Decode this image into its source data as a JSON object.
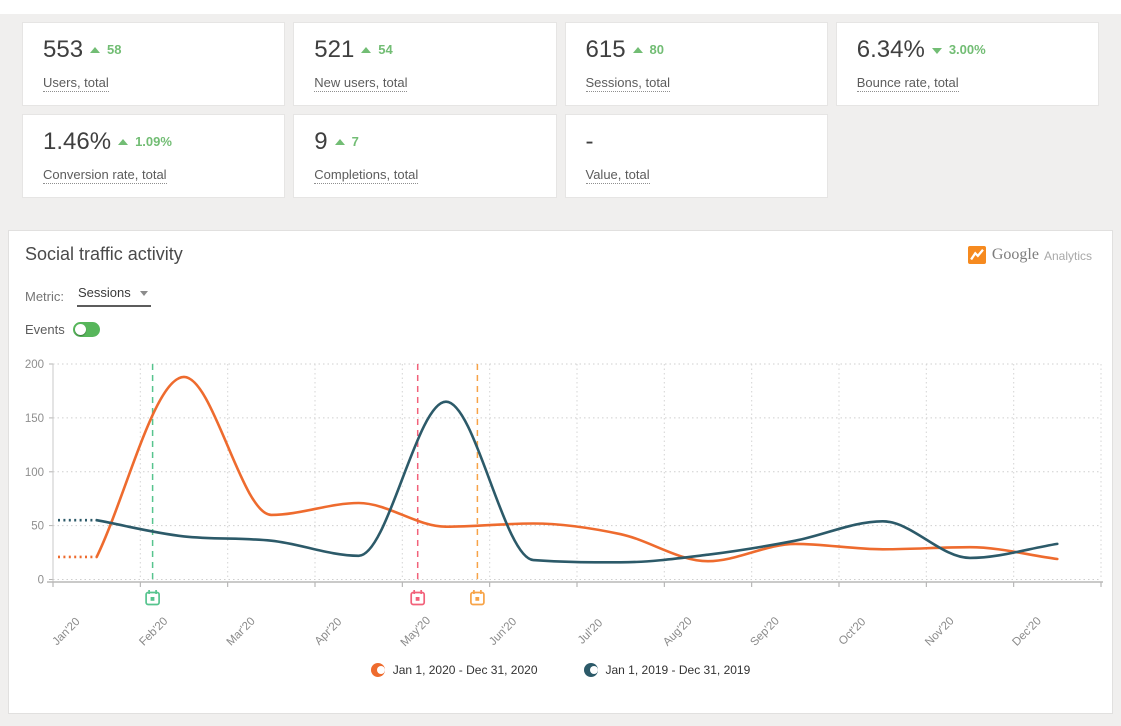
{
  "kpi_section": {
    "cards": [
      {
        "value": "553",
        "delta": "58",
        "direction": "up",
        "label": "Users, total"
      },
      {
        "value": "521",
        "delta": "54",
        "direction": "up",
        "label": "New users, total"
      },
      {
        "value": "615",
        "delta": "80",
        "direction": "up",
        "label": "Sessions, total"
      },
      {
        "value": "6.34%",
        "delta": "3.00%",
        "direction": "down",
        "label": "Bounce rate, total"
      },
      {
        "value": "1.46%",
        "delta": "1.09%",
        "direction": "up",
        "label": "Conversion rate, total"
      },
      {
        "value": "9",
        "delta": "7",
        "direction": "up",
        "label": "Completions, total"
      },
      {
        "value": "-",
        "delta": "",
        "direction": "none",
        "label": "Value, total"
      }
    ]
  },
  "panel": {
    "title": "Social traffic activity",
    "metric_label": "Metric:",
    "metric_value": "Sessions",
    "events_label": "Events",
    "events_on": true,
    "logo": {
      "brand": "Google",
      "product": "Analytics"
    }
  },
  "chart_data": {
    "type": "line",
    "title": "Social traffic activity",
    "metric": "Sessions",
    "categories": [
      "Jan'20",
      "Feb'20",
      "Mar'20",
      "Apr'20",
      "May'20",
      "Jun'20",
      "Jul'20",
      "Aug'20",
      "Sep'20",
      "Oct'20",
      "Nov'20",
      "Dec'20"
    ],
    "series": [
      {
        "name": "Jan 1, 2020 - Dec 31, 2020",
        "color": "#ee6b2e",
        "values": [
          21,
          188,
          60,
          71,
          49,
          52,
          42,
          17,
          33,
          28,
          30,
          19
        ]
      },
      {
        "name": "Jan 1, 2019 - Dec 31, 2019",
        "color": "#2c5a69",
        "values": [
          55,
          40,
          36,
          22,
          165,
          18,
          16,
          23,
          36,
          54,
          20,
          33
        ]
      }
    ],
    "y_ticks": [
      0,
      50,
      100,
      150,
      200
    ],
    "ylim": [
      0,
      200
    ],
    "xlabel": "",
    "ylabel": "",
    "grid": "dotted",
    "legend_position": "bottom",
    "event_markers": [
      {
        "color": "#56c48e",
        "x_frac": 0.095
      },
      {
        "color": "#f2617a",
        "x_frac": 0.348
      },
      {
        "color": "#f7a347",
        "x_frac": 0.405
      }
    ]
  },
  "colors": {
    "accent_green": "#72bd74",
    "toggle_green": "#57b65b",
    "orange": "#ee6b2e",
    "teal": "#2c5a69"
  }
}
